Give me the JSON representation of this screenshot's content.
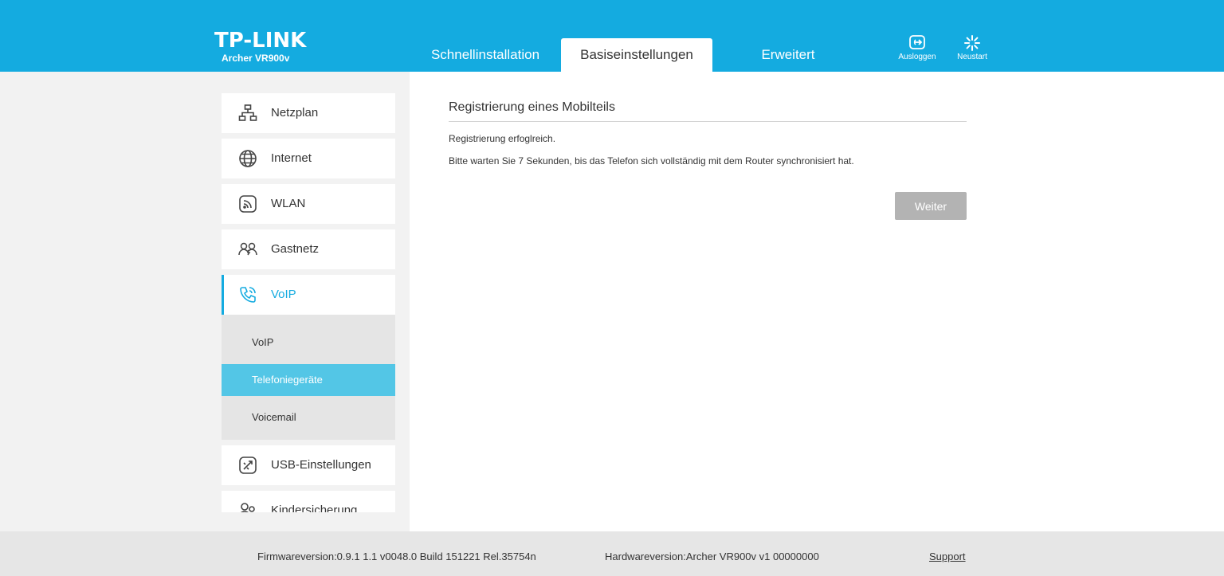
{
  "header": {
    "brand": "TP-LINK",
    "model": "Archer VR900v",
    "tabs": [
      {
        "label": "Schnellinstallation",
        "active": false
      },
      {
        "label": "Basiseinstellungen",
        "active": true
      },
      {
        "label": "Erweitert",
        "active": false
      }
    ],
    "logout_label": "Ausloggen",
    "restart_label": "Neustart"
  },
  "sidebar": {
    "items": [
      {
        "label": "Netzplan",
        "icon": "network-map-icon"
      },
      {
        "label": "Internet",
        "icon": "globe-icon"
      },
      {
        "label": "WLAN",
        "icon": "wifi-icon"
      },
      {
        "label": "Gastnetz",
        "icon": "guest-network-icon"
      },
      {
        "label": "VoIP",
        "icon": "phone-icon",
        "active": true
      },
      {
        "label": "USB-Einstellungen",
        "icon": "usb-icon"
      },
      {
        "label": "Kindersicherung",
        "icon": "parental-control-icon"
      }
    ],
    "submenu": [
      {
        "label": "VoIP"
      },
      {
        "label": "Telefoniegeräte",
        "active": true
      },
      {
        "label": "Voicemail"
      }
    ]
  },
  "main": {
    "title": "Registrierung eines Mobilteils",
    "message1": "Registrierung erfoglreich.",
    "message2": "Bitte warten Sie 7 Sekunden, bis das Telefon sich vollständig mit dem Router synchronisiert hat.",
    "next_label": "Weiter"
  },
  "footer": {
    "firmware": "Firmwareversion:0.9.1 1.1 v0048.0 Build 151221 Rel.35754n",
    "hardware": "Hardwareversion:Archer VR900v v1 00000000",
    "support": "Support"
  },
  "colors": {
    "brand_blue": "#14abe0",
    "active_submenu": "#53c6e6",
    "button_disabled": "#b3b3b3"
  }
}
